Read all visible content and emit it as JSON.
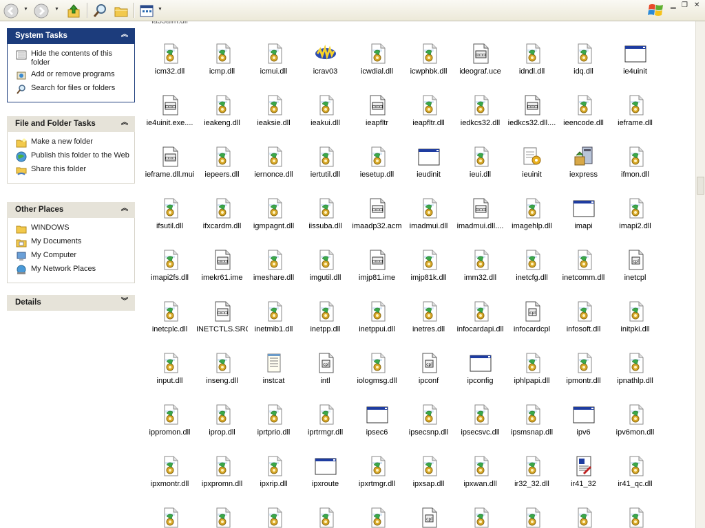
{
  "toolbar": {
    "buttons": [
      {
        "name": "back-button",
        "icon": "back-arrow-icon"
      },
      {
        "name": "forward-button",
        "icon": "forward-arrow-icon"
      },
      {
        "name": "up-button",
        "icon": "up-folder-icon"
      },
      {
        "name": "search-button",
        "icon": "search-icon"
      },
      {
        "name": "folders-button",
        "icon": "folders-icon"
      },
      {
        "name": "views-button",
        "icon": "views-icon"
      }
    ],
    "window_controls": [
      "minimize",
      "restore",
      "close"
    ]
  },
  "task_pane": {
    "system_tasks": {
      "title": "System Tasks",
      "items": [
        {
          "label": "Hide the contents of this folder",
          "icon": "hide-contents-icon"
        },
        {
          "label": "Add or remove programs",
          "icon": "add-remove-programs-icon"
        },
        {
          "label": "Search for files or folders",
          "icon": "search-icon"
        }
      ]
    },
    "file_folder_tasks": {
      "title": "File and Folder Tasks",
      "items": [
        {
          "label": "Make a new folder",
          "icon": "new-folder-icon"
        },
        {
          "label": "Publish this folder to the Web",
          "icon": "publish-web-icon"
        },
        {
          "label": "Share this folder",
          "icon": "share-folder-icon"
        }
      ]
    },
    "other_places": {
      "title": "Other Places",
      "items": [
        {
          "label": "WINDOWS",
          "icon": "folder-icon"
        },
        {
          "label": "My Documents",
          "icon": "my-documents-icon"
        },
        {
          "label": "My Computer",
          "icon": "my-computer-icon"
        },
        {
          "label": "My Network Places",
          "icon": "network-places-icon"
        }
      ]
    },
    "details": {
      "title": "Details"
    }
  },
  "files": [
    [
      {
        "name": "icm32.dll",
        "icon": "dll"
      },
      {
        "name": "icmp.dll",
        "icon": "dll"
      },
      {
        "name": "icmui.dll",
        "icon": "dll"
      },
      {
        "name": "icrav03",
        "icon": "icrav"
      },
      {
        "name": "icwdial.dll",
        "icon": "dll"
      },
      {
        "name": "icwphbk.dll",
        "icon": "dll"
      },
      {
        "name": "ideograf.uce",
        "icon": "binary"
      },
      {
        "name": "idndl.dll",
        "icon": "dll"
      },
      {
        "name": "idq.dll",
        "icon": "dll"
      },
      {
        "name": "ie4uinit",
        "icon": "exe"
      }
    ],
    [
      {
        "name": "ie4uinit.exe....",
        "icon": "binary"
      },
      {
        "name": "ieakeng.dll",
        "icon": "dll"
      },
      {
        "name": "ieaksie.dll",
        "icon": "dll"
      },
      {
        "name": "ieakui.dll",
        "icon": "dll"
      },
      {
        "name": "ieapfltr",
        "icon": "binary"
      },
      {
        "name": "ieapfltr.dll",
        "icon": "dll"
      },
      {
        "name": "iedkcs32.dll",
        "icon": "dll"
      },
      {
        "name": "iedkcs32.dll....",
        "icon": "binary"
      },
      {
        "name": "ieencode.dll",
        "icon": "dll"
      },
      {
        "name": "ieframe.dll",
        "icon": "dll"
      }
    ],
    [
      {
        "name": "ieframe.dll.mui",
        "icon": "binary"
      },
      {
        "name": "iepeers.dll",
        "icon": "dll"
      },
      {
        "name": "iernonce.dll",
        "icon": "dll"
      },
      {
        "name": "iertutil.dll",
        "icon": "dll"
      },
      {
        "name": "iesetup.dll",
        "icon": "dll"
      },
      {
        "name": "ieudinit",
        "icon": "exe"
      },
      {
        "name": "ieui.dll",
        "icon": "dll"
      },
      {
        "name": "ieuinit",
        "icon": "setup"
      },
      {
        "name": "iexpress",
        "icon": "iexpress"
      },
      {
        "name": "ifmon.dll",
        "icon": "dll"
      }
    ],
    [
      {
        "name": "ifsutil.dll",
        "icon": "dll"
      },
      {
        "name": "ifxcardm.dll",
        "icon": "dll"
      },
      {
        "name": "igmpagnt.dll",
        "icon": "dll"
      },
      {
        "name": "iissuba.dll",
        "icon": "dll"
      },
      {
        "name": "imaadp32.acm",
        "icon": "binary"
      },
      {
        "name": "imadmui.dll",
        "icon": "dll"
      },
      {
        "name": "imadmui.dll....",
        "icon": "binary"
      },
      {
        "name": "imagehlp.dll",
        "icon": "dll"
      },
      {
        "name": "imapi",
        "icon": "exe"
      },
      {
        "name": "imapi2.dll",
        "icon": "dll"
      }
    ],
    [
      {
        "name": "imapi2fs.dll",
        "icon": "dll"
      },
      {
        "name": "imekr61.ime",
        "icon": "binary"
      },
      {
        "name": "imeshare.dll",
        "icon": "dll"
      },
      {
        "name": "imgutil.dll",
        "icon": "dll"
      },
      {
        "name": "imjp81.ime",
        "icon": "binary"
      },
      {
        "name": "imjp81k.dll",
        "icon": "dll"
      },
      {
        "name": "imm32.dll",
        "icon": "dll"
      },
      {
        "name": "inetcfg.dll",
        "icon": "dll"
      },
      {
        "name": "inetcomm.dll",
        "icon": "dll"
      },
      {
        "name": "inetcpl",
        "icon": "cpl"
      }
    ],
    [
      {
        "name": "inetcplc.dll",
        "icon": "dll"
      },
      {
        "name": "INETCTLS.SRG",
        "icon": "binary"
      },
      {
        "name": "inetmib1.dll",
        "icon": "dll"
      },
      {
        "name": "inetpp.dll",
        "icon": "dll"
      },
      {
        "name": "inetppui.dll",
        "icon": "dll"
      },
      {
        "name": "inetres.dll",
        "icon": "dll"
      },
      {
        "name": "infocardapi.dll",
        "icon": "dll"
      },
      {
        "name": "infocardcpl",
        "icon": "cpl"
      },
      {
        "name": "infosoft.dll",
        "icon": "dll"
      },
      {
        "name": "initpki.dll",
        "icon": "dll"
      }
    ],
    [
      {
        "name": "input.dll",
        "icon": "dll"
      },
      {
        "name": "inseng.dll",
        "icon": "dll"
      },
      {
        "name": "instcat",
        "icon": "notepad"
      },
      {
        "name": "intl",
        "icon": "cpl"
      },
      {
        "name": "iologmsg.dll",
        "icon": "dll"
      },
      {
        "name": "ipconf",
        "icon": "cpl"
      },
      {
        "name": "ipconfig",
        "icon": "exe"
      },
      {
        "name": "iphlpapi.dll",
        "icon": "dll"
      },
      {
        "name": "ipmontr.dll",
        "icon": "dll"
      },
      {
        "name": "ipnathlp.dll",
        "icon": "dll"
      }
    ],
    [
      {
        "name": "ippromon.dll",
        "icon": "dll"
      },
      {
        "name": "iprop.dll",
        "icon": "dll"
      },
      {
        "name": "iprtprio.dll",
        "icon": "dll"
      },
      {
        "name": "iprtrmgr.dll",
        "icon": "dll"
      },
      {
        "name": "ipsec6",
        "icon": "exe"
      },
      {
        "name": "ipsecsnp.dll",
        "icon": "dll"
      },
      {
        "name": "ipsecsvc.dll",
        "icon": "dll"
      },
      {
        "name": "ipsmsnap.dll",
        "icon": "dll"
      },
      {
        "name": "ipv6",
        "icon": "exe"
      },
      {
        "name": "ipv6mon.dll",
        "icon": "dll"
      }
    ],
    [
      {
        "name": "ipxmontr.dll",
        "icon": "dll"
      },
      {
        "name": "ipxpromn.dll",
        "icon": "dll"
      },
      {
        "name": "ipxrip.dll",
        "icon": "dll"
      },
      {
        "name": "ipxroute",
        "icon": "exe"
      },
      {
        "name": "ipxrtmgr.dll",
        "icon": "dll"
      },
      {
        "name": "ipxsap.dll",
        "icon": "dll"
      },
      {
        "name": "ipxwan.dll",
        "icon": "dll"
      },
      {
        "name": "ir32_32.dll",
        "icon": "dll"
      },
      {
        "name": "ir41_32",
        "icon": "ir41"
      },
      {
        "name": "ir41_qc.dll",
        "icon": "dll"
      }
    ],
    [
      {
        "name": "",
        "icon": "dll"
      },
      {
        "name": "",
        "icon": "dll"
      },
      {
        "name": "",
        "icon": "dll"
      },
      {
        "name": "",
        "icon": "dll"
      },
      {
        "name": "",
        "icon": "dll"
      },
      {
        "name": "",
        "icon": "cpl"
      },
      {
        "name": "",
        "icon": "dll"
      },
      {
        "name": "",
        "icon": "dll"
      },
      {
        "name": "",
        "icon": "dll"
      },
      {
        "name": "",
        "icon": "dll"
      }
    ]
  ]
}
